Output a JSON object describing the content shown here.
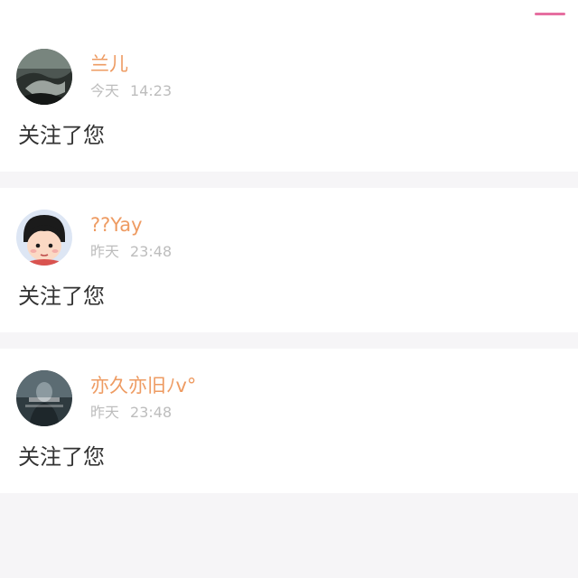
{
  "colors": {
    "accent": "#e66fa0",
    "username": "#ee9b62",
    "timestamp": "#bdbdbd",
    "message": "#333333",
    "card_bg": "#ffffff",
    "divider_bg": "#f6f5f7"
  },
  "notifications": [
    {
      "username": "兰儿",
      "day": "今天",
      "time": "14:23",
      "message": "关注了您",
      "avatar_icon": "avatar-photo-icon"
    },
    {
      "username": "??Yay",
      "day": "昨天",
      "time": "23:48",
      "message": "关注了您",
      "avatar_icon": "avatar-cartoon-icon"
    },
    {
      "username": "亦久亦旧ﾉv°",
      "day": "昨天",
      "time": "23:48",
      "message": "关注了您",
      "avatar_icon": "avatar-photo-icon"
    }
  ]
}
